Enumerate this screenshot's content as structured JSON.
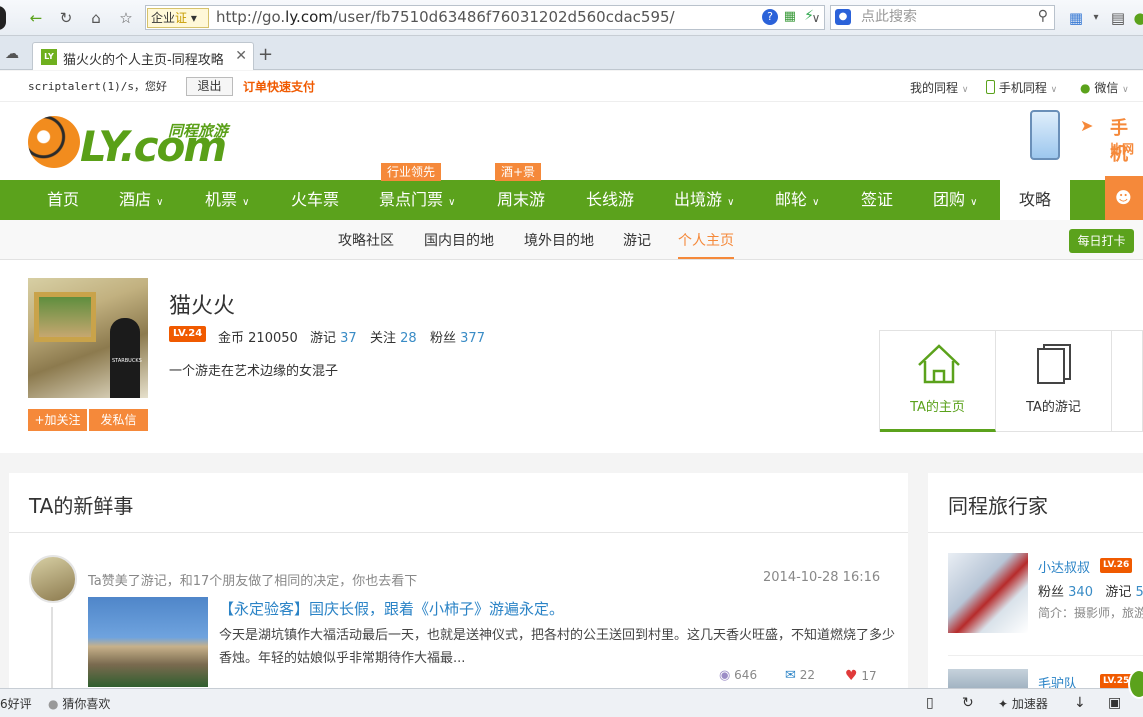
{
  "browser": {
    "badge_label": "企业",
    "badge_seal": "证",
    "url_prefix": "http://go.",
    "url_domain": "ly.com",
    "url_path": "/user/fb7510d63486f76031202d560cdac595/",
    "search_placeholder": "点此搜索",
    "tab_title": "猫火火的个人主页-同程攻略社",
    "favicon": "LY"
  },
  "topbar": {
    "username": "scriptalert(1)/s，您好",
    "logout": "退出",
    "quick_pay": "订单快速支付",
    "my_tongcheng": "我的同程",
    "mobile": "手机同程",
    "wechat": "微信"
  },
  "logo": {
    "text": "LY.com",
    "slogan": "同程旅游"
  },
  "phone_ad": {
    "title": "手机",
    "subtitle": "比网"
  },
  "nav": {
    "items": [
      "首页",
      "酒店",
      "机票",
      "火车票",
      "景点门票",
      "周末游",
      "长线游",
      "出境游",
      "邮轮",
      "签证",
      "团购",
      "攻略"
    ],
    "badge_scenic": "行业领先",
    "badge_weekend": "酒+景",
    "login": "我"
  },
  "subnav": {
    "items": [
      "攻略社区",
      "国内目的地",
      "境外目的地",
      "游记",
      "个人主页"
    ],
    "checkin": "每日打卡"
  },
  "profile": {
    "name": "猫火火",
    "level": "LV.24",
    "coins_label": "金币",
    "coins": "210050",
    "notes_label": "游记",
    "notes": "37",
    "follow_label": "关注",
    "follow": "28",
    "fans_label": "粉丝",
    "fans": "377",
    "bio": "一个游走在艺术边缘的女混子",
    "follow_btn": "+加关注",
    "message_btn": "发私信",
    "avatar_shirt": "STARBUCKS"
  },
  "profile_tabs": [
    {
      "label": "TA的主页",
      "icon": "home-icon",
      "active": true
    },
    {
      "label": "TA的游记",
      "icon": "notes-icon",
      "active": false
    }
  ],
  "feed": {
    "title": "TA的新鲜事",
    "item": {
      "text": "Ta赞美了游记，和17个朋友做了相同的决定，你也去看下",
      "date": "2014-10-28 16:16",
      "title": "【永定验客】国庆长假，跟着《小柿子》游遍永定。",
      "body": "今天是湖坑镇作大福活动最后一天，也就是送神仪式，把各村的公王送回到村里。这几天香火旺盛，不知道燃烧了多少香烛。年轻的姑娘似乎非常期待作大福最...",
      "views": "646",
      "comments": "22",
      "likes": "17"
    }
  },
  "side": {
    "title": "同程旅行家",
    "user": {
      "name": "小达叔叔",
      "level": "LV.26",
      "fans_label": "粉丝",
      "fans": "340",
      "notes_label": "游记",
      "notes": "5",
      "intro": "简介：摄影师，旅游"
    },
    "user2_name": "毛驴队",
    "user2_level": "LV.25"
  },
  "statusbar": {
    "left1": "6好评",
    "left2": "猜你喜欢",
    "accelerator": "加速器"
  },
  "colors": {
    "green": "#5ba21c",
    "orange": "#f5893a",
    "link": "#2a83c6"
  }
}
